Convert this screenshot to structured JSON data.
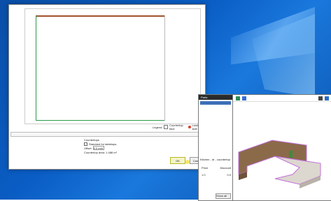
{
  "dialog": {
    "legend_label": "Legend:",
    "legend_item_1": "Countertop face",
    "legend_item_2": "Lwall side",
    "props": {
      "heading": "Countertops",
      "checkbox_label": "Standard for tabletops",
      "offset_label": "Offset",
      "offset_value": "0.0 mm",
      "area_label": "Countertop area: 1.488 m²"
    },
    "ok_label": "OK",
    "cancel_label": "Cancel"
  },
  "side_panel": {
    "header": "Parts",
    "list_label": "Kitchen - dr - countertop",
    "col_1": "Price",
    "col_2": "Discount",
    "row_qty": "1.0",
    "row_price": "0.0",
    "bottom_button": "Show all"
  },
  "colors": {
    "wall_brown": "#a0522d",
    "outline_green": "#2a9a4a",
    "desktop_blue": "#0a5dc4"
  }
}
